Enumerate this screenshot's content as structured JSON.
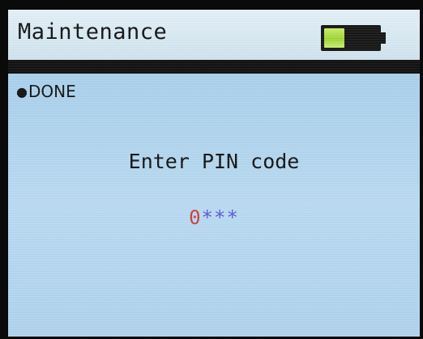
{
  "header": {
    "title": "Maintenance",
    "battery_level": 0.38,
    "battery_color": "#a8dc3c"
  },
  "status": {
    "bullet": "●",
    "label": "DONE"
  },
  "prompt": {
    "text": "Enter PIN code"
  },
  "pin": {
    "active_digit": "0",
    "masked": "***",
    "active_color": "#d23a3a",
    "masked_color": "#5a57d8"
  }
}
